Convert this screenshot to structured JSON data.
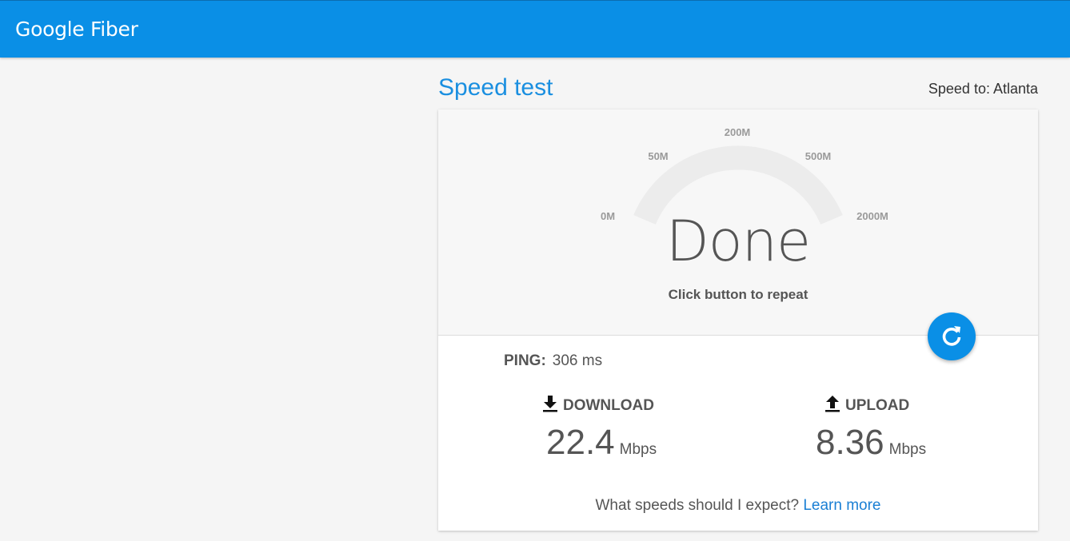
{
  "header": {
    "logo_text": "Google Fiber",
    "brand_color": "#0a8fe6"
  },
  "page": {
    "title": "Speed test",
    "speed_to": "Speed to: Atlanta"
  },
  "gauge": {
    "ticks": [
      "0M",
      "50M",
      "200M",
      "500M",
      "2000M"
    ],
    "status": "Done",
    "hint": "Click button to repeat",
    "repeat_icon": "refresh-icon"
  },
  "results": {
    "ping_label": "PING:",
    "ping_value": "306 ms",
    "download_label": "DOWNLOAD",
    "download_value": "22.4",
    "download_unit": "Mbps",
    "download_icon": "download-icon",
    "upload_label": "UPLOAD",
    "upload_value": "8.36",
    "upload_unit": "Mbps",
    "upload_icon": "upload-icon"
  },
  "footer": {
    "question": "What speeds should I expect?",
    "link": "Learn more"
  }
}
